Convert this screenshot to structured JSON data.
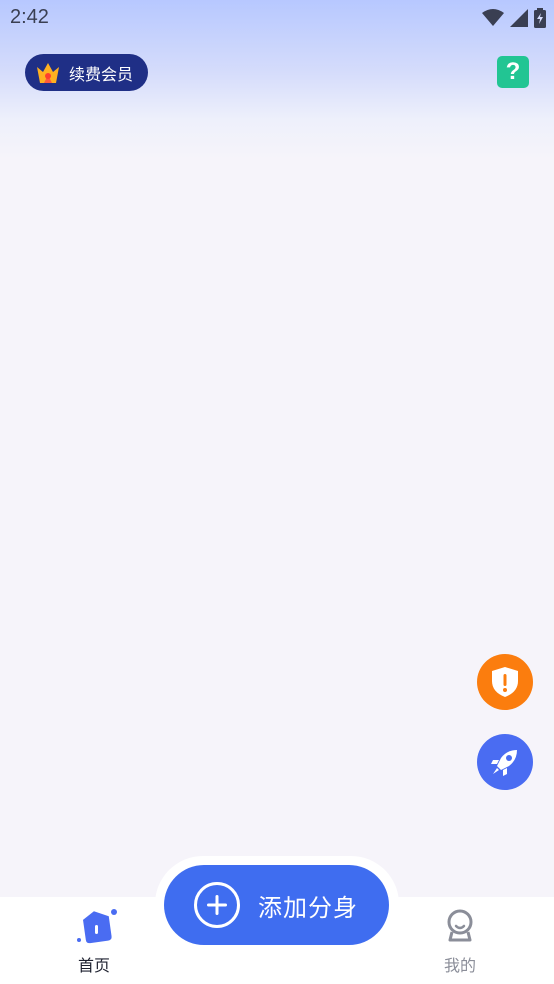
{
  "status_bar": {
    "time": "2:42",
    "icons": [
      "wifi-icon",
      "signal-icon",
      "battery-charging-icon"
    ]
  },
  "header": {
    "member_button_label": "续费会员",
    "member_icon": "crown-icon",
    "help_icon_label": "?"
  },
  "floating_buttons": [
    {
      "name": "shield-warning-icon",
      "color": "#fb7d0e"
    },
    {
      "name": "rocket-icon",
      "color": "#4a6cf2"
    }
  ],
  "add_button": {
    "label": "添加分身",
    "icon": "plus-circle-icon",
    "color": "#3f6df0"
  },
  "bottom_nav": {
    "items": [
      {
        "label": "首页",
        "icon": "home-icon",
        "active": true
      },
      {
        "label": "我的",
        "icon": "profile-icon",
        "active": false
      }
    ]
  },
  "colors": {
    "accent": "#3f6df0",
    "help": "#22c593",
    "member_pill": "#1f2f86"
  }
}
